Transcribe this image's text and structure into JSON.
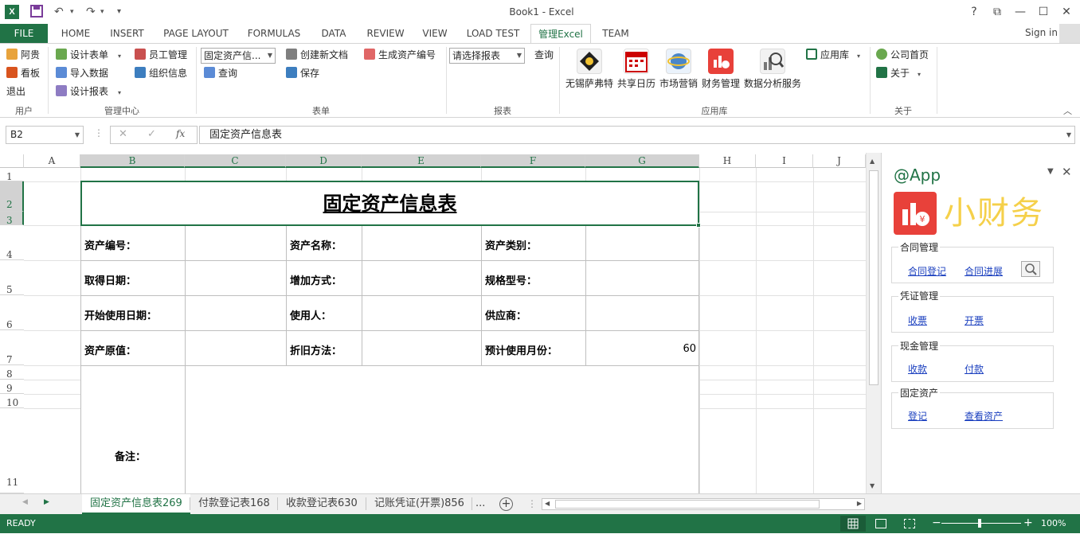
{
  "window": {
    "title": "Book1 - Excel",
    "help": "?",
    "restore": "⧉",
    "minimize": "—",
    "maximize": "☐",
    "close": "✕"
  },
  "quick_access": {
    "save": "💾",
    "undo": "↶",
    "redo": "↷",
    "more": "▾"
  },
  "ribbon_tabs": [
    "FILE",
    "HOME",
    "INSERT",
    "PAGE LAYOUT",
    "FORMULAS",
    "DATA",
    "REVIEW",
    "VIEW",
    "LOAD TEST",
    "管理Excel",
    "TEAM"
  ],
  "active_tab": "管理Excel",
  "sign_in": "Sign in",
  "ribbon": {
    "user": {
      "items": [
        "阿贵",
        "看板",
        "退出"
      ],
      "label": "用户"
    },
    "mgmt": {
      "items": [
        "设计表单",
        "导入数据",
        "设计报表",
        "员工管理",
        "组织信息"
      ],
      "label": "管理中心"
    },
    "form": {
      "combo": "固定资产信...",
      "query": "查询",
      "new_doc": "创建新文档",
      "save": "保存",
      "gen_no": "生成资产编号",
      "label": "表单"
    },
    "report": {
      "combo": "请选择报表",
      "query": "查询",
      "label": "报表"
    },
    "apps": {
      "items": [
        "无锡萨弗特",
        "共享日历",
        "市场营销",
        "财务管理",
        "数据分析服务"
      ],
      "store": "应用库",
      "label": "应用库"
    },
    "about": {
      "home": "公司首页",
      "about": "关于",
      "label": "关于"
    }
  },
  "formula_bar": {
    "name_box": "B2",
    "fx": "fx",
    "content": "固定资产信息表"
  },
  "columns": [
    "A",
    "B",
    "C",
    "D",
    "E",
    "F",
    "G",
    "H",
    "I",
    "J"
  ],
  "rows": [
    "1",
    "2",
    "3",
    "4",
    "5",
    "6",
    "7",
    "8",
    "9",
    "10",
    "11"
  ],
  "sheet": {
    "title": "固定资产信息表",
    "labels": {
      "asset_no": "资产编号：",
      "asset_name": "资产名称：",
      "asset_type": "资产类别：",
      "acq_date": "取得日期：",
      "add_method": "增加方式：",
      "spec": "规格型号：",
      "start_date": "开始使用日期：",
      "user": "使用人：",
      "supplier": "供应商：",
      "orig_value": "资产原值：",
      "dep_method": "折旧方法：",
      "est_months": "预计使用月份：",
      "remarks": "备注："
    },
    "est_months_value": "60"
  },
  "pane": {
    "handle": "@App",
    "app_name": "小财务",
    "groups": [
      {
        "title": "合同管理",
        "links": [
          "合同登记",
          "合同进展"
        ]
      },
      {
        "title": "凭证管理",
        "links": [
          "收票",
          "开票"
        ]
      },
      {
        "title": "现金管理",
        "links": [
          "收款",
          "付款"
        ]
      },
      {
        "title": "固定资产",
        "links": [
          "登记",
          "查看资产"
        ]
      }
    ]
  },
  "sheet_tabs": [
    "固定资产信息表269",
    "付款登记表168",
    "收款登记表630",
    "记账凭证(开票)856",
    "..."
  ],
  "status": {
    "ready": "READY",
    "zoom": "100%"
  },
  "colors": {
    "accent": "#217346",
    "selected_header": "#d2d2d2",
    "link": "#1a3fbf"
  }
}
